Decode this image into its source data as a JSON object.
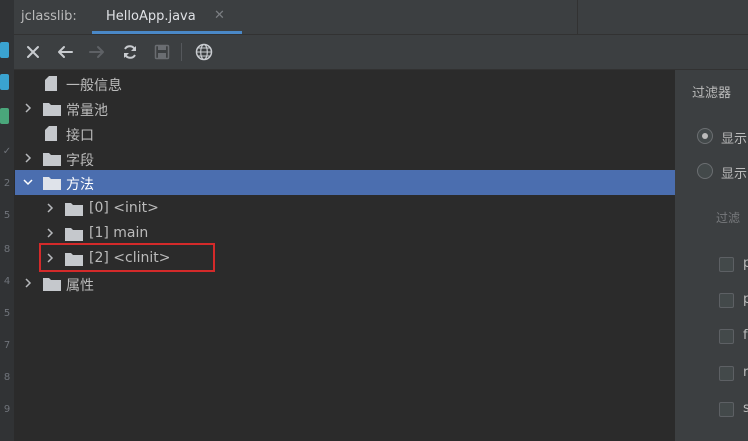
{
  "tool_window": {
    "title": "jclasslib:"
  },
  "editor_tab": {
    "label": "HelloApp.java",
    "close_glyph": "✕"
  },
  "toolbar": {
    "buttons": [
      {
        "icon": "close-icon"
      },
      {
        "icon": "back-arrow-icon"
      },
      {
        "icon": "forward-arrow-icon",
        "enabled": false
      },
      {
        "icon": "refresh-icon"
      },
      {
        "icon": "save-icon",
        "enabled": false
      },
      {
        "icon": "globe-icon"
      }
    ]
  },
  "tree": {
    "items": [
      {
        "label": "一般信息",
        "icon": "file-icon",
        "expandable": false,
        "level": 0
      },
      {
        "label": "常量池",
        "icon": "folder-icon",
        "expandable": true,
        "expanded": false,
        "level": 0
      },
      {
        "label": "接口",
        "icon": "file-icon",
        "expandable": false,
        "level": 0
      },
      {
        "label": "字段",
        "icon": "folder-icon",
        "expandable": true,
        "expanded": false,
        "level": 0
      },
      {
        "label": "方法",
        "icon": "folder-icon",
        "expandable": true,
        "expanded": true,
        "selected": true,
        "level": 0
      },
      {
        "label": "[0] <init>",
        "icon": "folder-icon",
        "expandable": true,
        "expanded": false,
        "level": 1
      },
      {
        "label": "[1] main",
        "icon": "folder-icon",
        "expandable": true,
        "expanded": false,
        "level": 1
      },
      {
        "label": "[2] <clinit>",
        "icon": "folder-icon",
        "expandable": true,
        "expanded": false,
        "level": 1,
        "highlighted": true
      },
      {
        "label": "属性",
        "icon": "folder-icon",
        "expandable": true,
        "expanded": false,
        "level": 0
      }
    ]
  },
  "filter_panel": {
    "title": "过滤器",
    "radio_options": [
      {
        "label": "显示",
        "checked": true
      },
      {
        "label": "显示",
        "checked": false
      }
    ],
    "subtitle": "过滤",
    "checkbox_options": [
      "p",
      "p",
      "f",
      "r",
      "s"
    ]
  },
  "gutter": {
    "marks": [
      "✓",
      "2",
      "5",
      "8",
      "4",
      "5",
      "7",
      "8",
      "9"
    ]
  },
  "colors": {
    "selection": "#4b6eaf",
    "highlight_box": "#d42a2a",
    "tab_underline": "#4a88c7",
    "background": "#2b2b2b"
  }
}
